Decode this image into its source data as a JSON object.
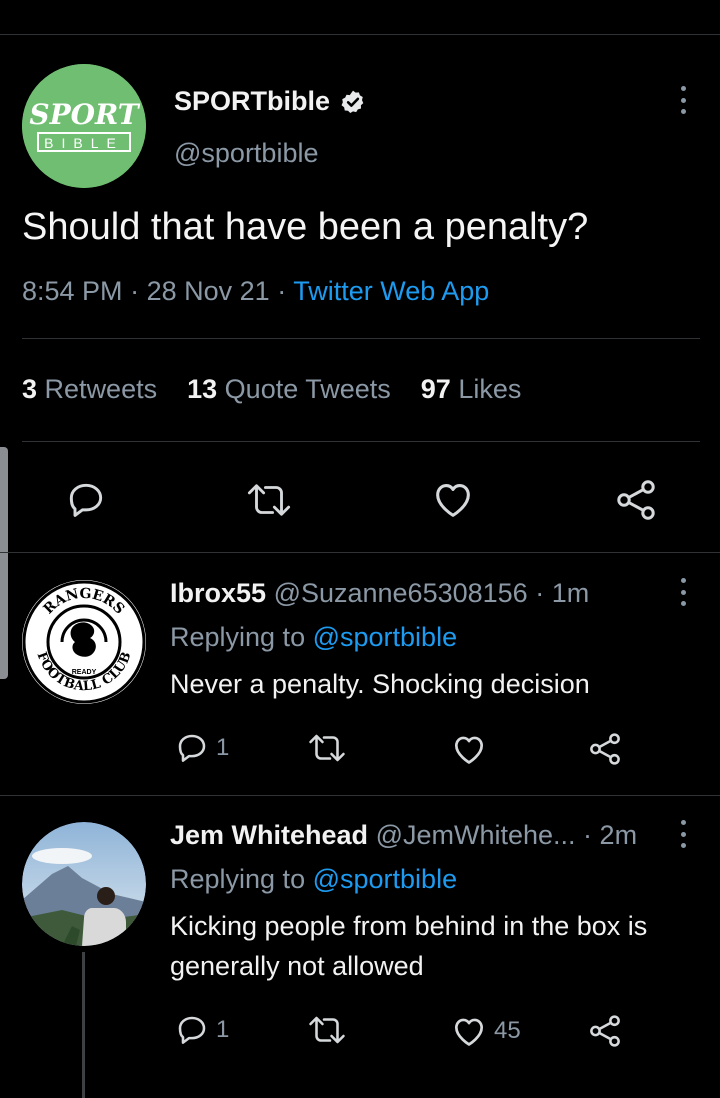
{
  "tweet": {
    "display_name": "SPORTbible",
    "handle": "@sportbible",
    "avatar_text_top": "SPORT",
    "avatar_text_bottom": "BIBLE",
    "text": "Should that have been a penalty?",
    "time": "8:54 PM",
    "date": "28 Nov 21",
    "source": "Twitter Web App",
    "stats": {
      "retweets_count": "3",
      "retweets_label": "Retweets",
      "quotes_count": "13",
      "quotes_label": "Quote Tweets",
      "likes_count": "97",
      "likes_label": "Likes"
    }
  },
  "replies": [
    {
      "display_name": "Ibrox55",
      "handle": "@Suzanne65308156",
      "time": "1m",
      "replying_label": "Replying to",
      "replying_to": "@sportbible",
      "text": "Never a penalty. Shocking decision",
      "reply_count": "1",
      "like_count": "",
      "avatar_ring_top": "RANGERS",
      "avatar_ring_bottom": "FOOTBALL CLUB",
      "avatar_motto": "READY"
    },
    {
      "display_name": "Jem Whitehead",
      "handle": "@JemWhitehe...",
      "time": "2m",
      "replying_label": "Replying to",
      "replying_to": "@sportbible",
      "text": "Kicking people from behind in the box is generally not allowed",
      "reply_count": "1",
      "like_count": "45"
    }
  ],
  "colors": {
    "background": "#000000",
    "accent": "#1d9bf0",
    "secondary_text": "#8b98a5",
    "avatar_green": "#6fbe71"
  }
}
